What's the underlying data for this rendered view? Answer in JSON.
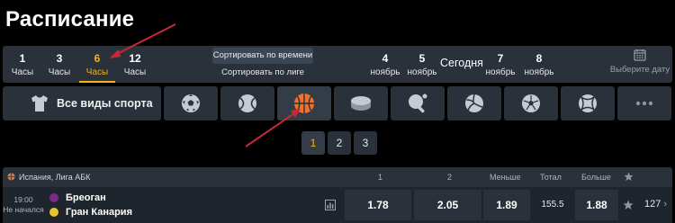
{
  "page_title": "Расписание",
  "hours": [
    {
      "num": "1",
      "unit": "Часы"
    },
    {
      "num": "3",
      "unit": "Часы"
    },
    {
      "num": "6",
      "unit": "Часы"
    },
    {
      "num": "12",
      "unit": "Часы"
    }
  ],
  "sort": {
    "by_time": "Сортировать по времени",
    "by_league": "Сортировать по лиге"
  },
  "days": [
    {
      "num": "4",
      "unit": "ноябрь"
    },
    {
      "num": "5",
      "unit": "ноябрь"
    },
    {
      "num": "7",
      "unit": "ноябрь"
    },
    {
      "num": "8",
      "unit": "ноябрь"
    }
  ],
  "today": "Сегодня",
  "date_picker": "Выберите дату",
  "sports": {
    "all_label": "Все виды спорта",
    "icons": [
      "soccer-ball-icon",
      "tennis-ball-icon",
      "basketball-icon",
      "hockey-puck-icon",
      "table-tennis-icon",
      "volleyball-icon",
      "futsal-ball-icon",
      "handball-icon",
      "more-icon"
    ]
  },
  "pagination": [
    "1",
    "2",
    "3"
  ],
  "event_header": {
    "league": "Испания, Лига АБК",
    "col_1": "1",
    "col_2": "2",
    "col_under": "Меньше",
    "col_total": "Тотал",
    "col_over": "Больше"
  },
  "event": {
    "time": "19:00",
    "status": "Не начался",
    "team1": "Бреоган",
    "team2": "Гран Канария",
    "odd_1": "1.78",
    "odd_2": "2.05",
    "under": "1.89",
    "total": "155.5",
    "over": "1.88",
    "more_count": "127"
  },
  "colors": {
    "accent": "#f4b319",
    "panel": "#2a313b",
    "arrow": "#c62a3a",
    "basketball": "#f0712a"
  }
}
